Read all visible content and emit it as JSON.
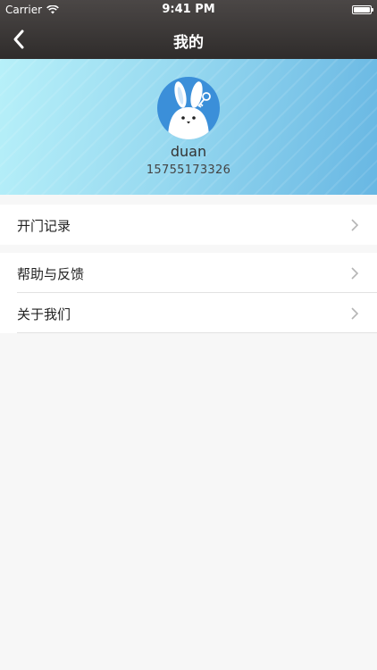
{
  "status_bar": {
    "carrier": "Carrier",
    "time": "9:41 PM",
    "wifi_icon": "wifi-icon",
    "battery_icon": "battery-icon"
  },
  "nav": {
    "title": "我的",
    "back_icon": "chevron-left-icon"
  },
  "profile": {
    "avatar_icon": "rabbit-avatar",
    "name": "duan",
    "phone": "15755173326"
  },
  "menu": {
    "group1": [
      {
        "label": "开门记录",
        "icon": "chevron-right-icon"
      }
    ],
    "group2": [
      {
        "label": "帮助与反馈",
        "icon": "chevron-right-icon"
      },
      {
        "label": "关于我们",
        "icon": "chevron-right-icon"
      }
    ]
  },
  "colors": {
    "nav_bg": "#3a3736",
    "header_gradient_start": "#b7f0f9",
    "header_gradient_end": "#68b7e3",
    "avatar_bg": "#3b8fd9",
    "page_bg": "#f7f7f7"
  }
}
